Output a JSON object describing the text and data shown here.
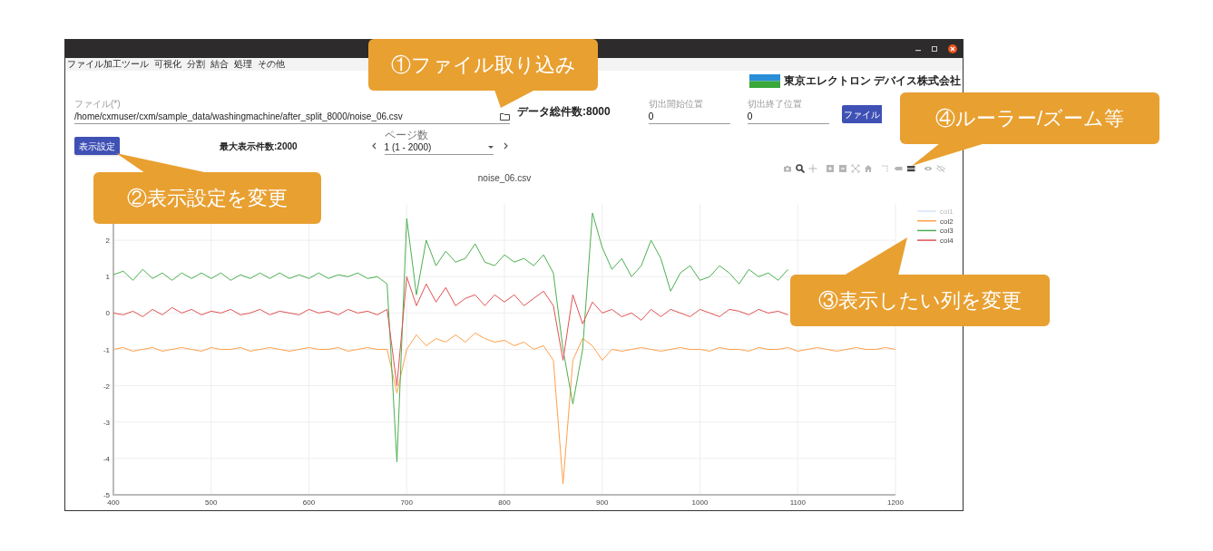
{
  "menu": [
    "ファイル加工ツール",
    "可視化",
    "分割",
    "結合",
    "処理",
    "その他"
  ],
  "logo": {
    "text": "東京エレクトロン デバイス株式会社"
  },
  "file_field": {
    "label": "ファイル(*)",
    "value": "/home/cxmuser/cxm/sample_data/washingmachine/after_split_8000/noise_06.csv"
  },
  "total_count": "データ総件数:8000",
  "start_field": {
    "label": "切出開始位置",
    "value": "0"
  },
  "end_field": {
    "label": "切出終了位置",
    "value": "0"
  },
  "file_button": "ファイル",
  "display_button": "表示設定",
  "max_count": "最大表示件数:2000",
  "page_select": {
    "label": "ページ数",
    "value": "1 (1 - 2000)"
  },
  "toolbar": [
    {
      "kind": "camera",
      "selected": false
    },
    {
      "kind": "zoom",
      "selected": true
    },
    {
      "kind": "pan",
      "selected": false
    },
    {
      "kind": "zoom-in",
      "selected": false
    },
    {
      "kind": "zoom-out",
      "selected": false
    },
    {
      "kind": "autoscale",
      "selected": false
    },
    {
      "kind": "home",
      "selected": false
    },
    {
      "kind": "spikes",
      "selected": false
    },
    {
      "kind": "hover-closest",
      "selected": false
    },
    {
      "kind": "hover-compare",
      "selected": true
    },
    {
      "kind": "show",
      "selected": false
    },
    {
      "kind": "hide",
      "selected": false
    }
  ],
  "chart_data": {
    "type": "line",
    "title": "noise_06.csv",
    "xlim": [
      400,
      1200
    ],
    "ylim": [
      -5,
      3
    ],
    "xticks": [
      400,
      500,
      600,
      700,
      800,
      900,
      1000,
      1100,
      1200
    ],
    "yticks": [
      -5,
      -4,
      -3,
      -2,
      -1,
      0,
      1,
      2
    ],
    "grid": true,
    "legend": true,
    "x": [
      400,
      410,
      420,
      430,
      440,
      450,
      460,
      470,
      480,
      490,
      500,
      510,
      520,
      530,
      540,
      550,
      560,
      570,
      580,
      590,
      600,
      610,
      620,
      630,
      640,
      650,
      660,
      670,
      680,
      690,
      700,
      710,
      720,
      730,
      740,
      750,
      760,
      770,
      780,
      790,
      800,
      810,
      820,
      830,
      840,
      850,
      860,
      870,
      880,
      890,
      900,
      910,
      920,
      930,
      940,
      950,
      960,
      970,
      980,
      990,
      1000,
      1010,
      1020,
      1030,
      1040,
      1050,
      1060,
      1070,
      1080,
      1090,
      1100,
      1110,
      1120,
      1130,
      1140,
      1150,
      1160,
      1170,
      1180,
      1190,
      1200
    ],
    "series": [
      {
        "name": "col1",
        "color": "#aec7e8",
        "values": [
          null,
          null,
          null,
          null,
          null,
          null,
          null,
          null,
          null,
          null,
          null,
          null,
          null,
          null,
          null,
          null,
          null,
          null,
          null,
          null,
          null,
          null,
          null,
          null,
          null,
          null,
          null,
          null,
          null,
          null,
          null,
          null,
          null,
          null,
          null,
          null,
          null,
          null,
          null,
          null,
          null,
          null,
          null,
          null,
          null,
          null,
          null,
          null,
          null,
          null,
          null,
          null,
          null,
          null,
          null,
          null,
          null,
          null,
          null,
          null,
          null,
          null,
          null,
          null,
          null,
          null,
          null,
          null,
          null,
          null,
          null,
          null,
          null,
          null,
          null,
          null,
          null,
          null,
          null,
          null,
          null
        ]
      },
      {
        "name": "col2",
        "color": "#ff9f4a",
        "values": [
          -1.0,
          -0.95,
          -1.05,
          -1.0,
          -0.95,
          -1.05,
          -1.0,
          -0.95,
          -1.0,
          -1.05,
          -0.95,
          -1.0,
          -1.0,
          -0.95,
          -1.05,
          -1.0,
          -0.95,
          -1.0,
          -1.05,
          -1.0,
          -0.95,
          -1.0,
          -1.0,
          -0.95,
          -1.05,
          -1.0,
          -0.95,
          -1.0,
          -1.0,
          -2.2,
          -1.0,
          -0.6,
          -0.9,
          -0.7,
          -0.8,
          -0.6,
          -0.8,
          -0.55,
          -0.7,
          -0.8,
          -0.75,
          -0.9,
          -0.8,
          -1.0,
          -0.9,
          -1.3,
          -4.7,
          -1.3,
          -0.7,
          -0.9,
          -1.3,
          -1.0,
          -1.05,
          -1.0,
          -0.95,
          -1.0,
          -1.05,
          -1.0,
          -0.95,
          -1.0,
          -1.0,
          -1.05,
          -0.95,
          -1.0,
          -1.0,
          -1.05,
          -0.95,
          -1.0,
          -1.0,
          -0.95,
          -1.05,
          -1.0,
          -0.95,
          -1.0,
          -1.05,
          -1.0,
          -0.95,
          -1.0,
          -1.0,
          -0.95,
          -1.0
        ]
      },
      {
        "name": "col3",
        "color": "#4caf50",
        "values": [
          1.05,
          1.15,
          0.9,
          1.2,
          0.95,
          1.1,
          0.9,
          1.1,
          0.95,
          1.1,
          0.95,
          1.1,
          0.9,
          1.05,
          0.95,
          1.1,
          0.95,
          1.1,
          0.95,
          1.05,
          0.95,
          1.1,
          0.95,
          1.05,
          1.0,
          1.1,
          0.95,
          1.0,
          0.8,
          -4.1,
          2.6,
          0.5,
          2.0,
          1.3,
          1.7,
          1.4,
          1.5,
          1.9,
          1.4,
          1.3,
          1.6,
          1.4,
          1.5,
          1.3,
          1.6,
          1.1,
          -1.0,
          -2.5,
          -1.0,
          2.75,
          1.8,
          1.2,
          1.5,
          1.0,
          1.3,
          2.0,
          1.5,
          0.6,
          1.1,
          1.3,
          0.9,
          1.0,
          1.3,
          1.1,
          0.8,
          1.2,
          1.0,
          1.1,
          0.9,
          1.2,
          null,
          null,
          null,
          null,
          null,
          null,
          null,
          null,
          null,
          null,
          null
        ]
      },
      {
        "name": "col4",
        "color": "#e05252",
        "values": [
          0.0,
          -0.05,
          0.05,
          -0.1,
          0.1,
          -0.05,
          0.15,
          0.0,
          0.1,
          -0.05,
          0.05,
          0.0,
          0.1,
          -0.05,
          0.0,
          0.1,
          -0.05,
          0.05,
          0.0,
          -0.05,
          0.1,
          0.0,
          0.05,
          -0.05,
          0.1,
          0.0,
          0.05,
          -0.05,
          0.1,
          -2.0,
          1.0,
          0.2,
          0.8,
          0.3,
          0.7,
          0.2,
          0.4,
          0.5,
          0.2,
          0.5,
          0.3,
          0.5,
          0.2,
          0.4,
          0.6,
          0.2,
          -1.3,
          0.5,
          -0.3,
          0.3,
          0.0,
          0.1,
          -0.1,
          0.0,
          -0.2,
          0.1,
          -0.1,
          0.1,
          0.0,
          -0.1,
          0.1,
          0.0,
          -0.1,
          0.1,
          0.05,
          -0.05,
          0.1,
          0.0,
          0.05,
          -0.05,
          null,
          null,
          null,
          null,
          null,
          null,
          null,
          null,
          null,
          null,
          null
        ]
      }
    ]
  },
  "callouts": [
    {
      "text": "①ファイル取り込み"
    },
    {
      "text": "②表示設定を変更"
    },
    {
      "text": "③表示したい列を変更"
    },
    {
      "text": "④ルーラー/ズーム等"
    }
  ]
}
